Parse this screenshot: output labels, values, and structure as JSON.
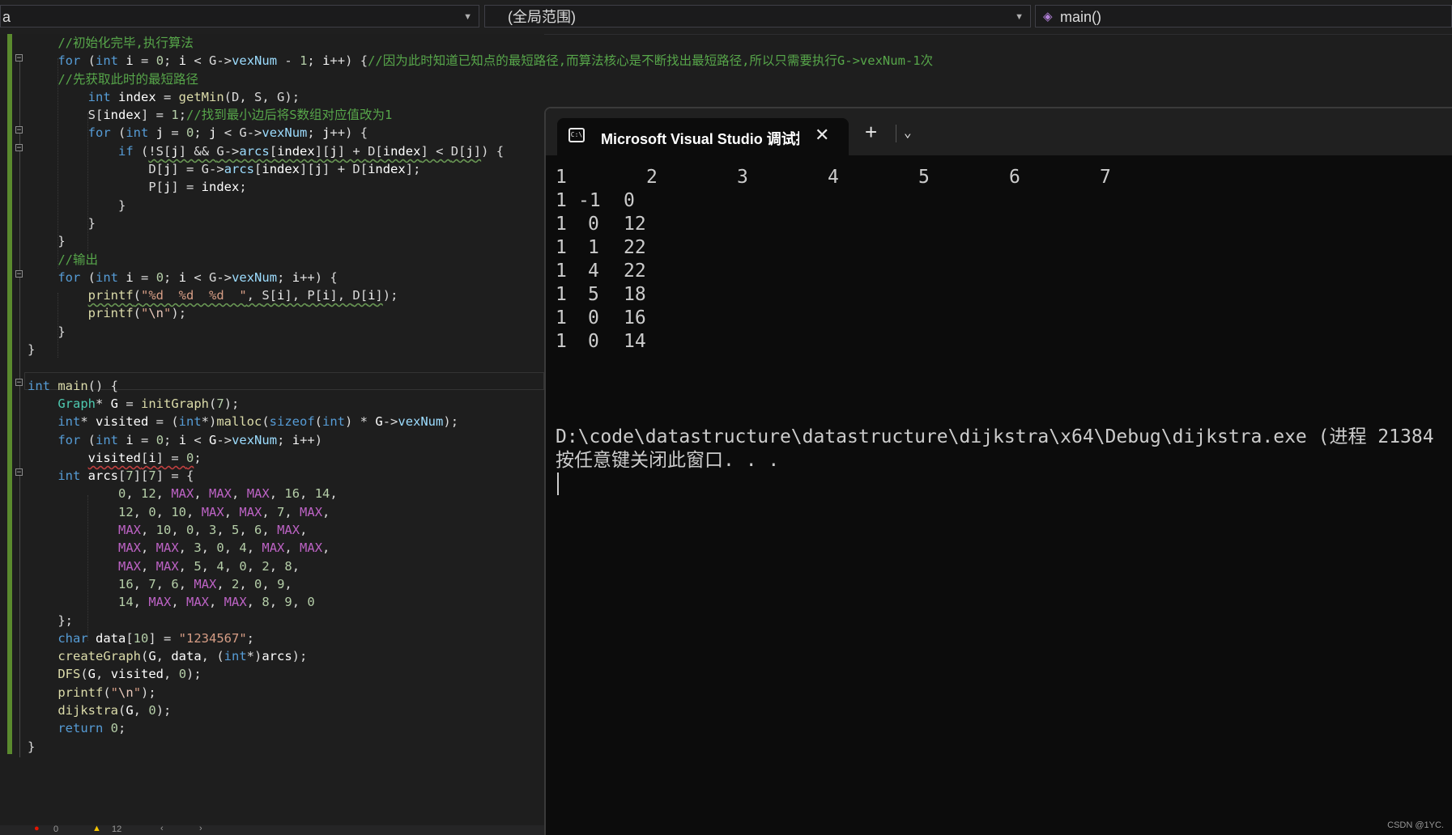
{
  "nav": {
    "project": "a",
    "scope": "(全局范围)",
    "function": "main()"
  },
  "terminal": {
    "tab_title": "Microsoft Visual Studio 调试控制台",
    "header": [
      "1",
      "2",
      "3",
      "4",
      "5",
      "6",
      "7"
    ],
    "rows": [
      [
        "1",
        "-1",
        "0"
      ],
      [
        "1",
        "0",
        "12"
      ],
      [
        "1",
        "1",
        "22"
      ],
      [
        "1",
        "4",
        "22"
      ],
      [
        "1",
        "5",
        "18"
      ],
      [
        "1",
        "0",
        "16"
      ],
      [
        "1",
        "0",
        "14"
      ]
    ],
    "exit_line": "D:\\code\\datastructure\\datastructure\\dijkstra\\x64\\Debug\\dijkstra.exe (进程 21384",
    "close_prompt": "按任意键关闭此窗口. . ."
  },
  "status": {
    "errors": "0",
    "warnings": "12"
  },
  "watermark": "CSDN @1YC.",
  "colors": {
    "editor_bg": "#1e1e1e",
    "terminal_bg": "#0c0c0c",
    "keyword": "#569cd6",
    "comment": "#57a64a",
    "macro": "#bd63c5",
    "change_bar": "#5a8a2e"
  }
}
